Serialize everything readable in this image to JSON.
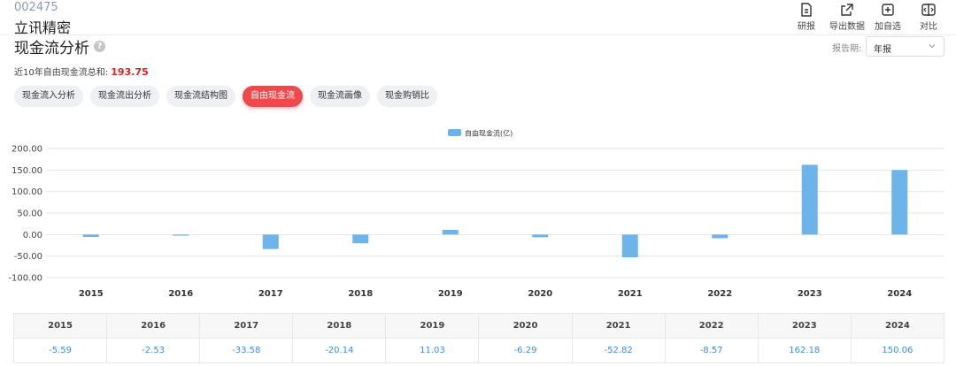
{
  "header": {
    "stock_code": "002475",
    "stock_name": "立讯精密"
  },
  "toolbar": [
    {
      "label": "研报",
      "icon": "report-icon"
    },
    {
      "label": "导出数据",
      "icon": "export-icon"
    },
    {
      "label": "加自选",
      "icon": "add-watchlist-icon"
    },
    {
      "label": "对比",
      "icon": "compare-icon"
    }
  ],
  "section": {
    "title": "现金流分析",
    "help_icon": "?",
    "period_label": "报告期:",
    "period_value": "年报"
  },
  "summary": {
    "label": "近10年自由现金流总和:",
    "value": "193.75"
  },
  "tabs": [
    {
      "label": "现金流入分析",
      "active": false
    },
    {
      "label": "现金流出分析",
      "active": false
    },
    {
      "label": "现金流结构图",
      "active": false
    },
    {
      "label": "自由现金流",
      "active": true
    },
    {
      "label": "现金流画像",
      "active": false
    },
    {
      "label": "现金购销比",
      "active": false
    }
  ],
  "chart_data": {
    "type": "bar",
    "categories": [
      "2015",
      "2016",
      "2017",
      "2018",
      "2019",
      "2020",
      "2021",
      "2022",
      "2023",
      "2024"
    ],
    "series": [
      {
        "name": "自由现金流(亿)",
        "values": [
          -5.59,
          -2.53,
          -33.58,
          -20.14,
          11.03,
          -6.29,
          -52.82,
          -8.57,
          162.18,
          150.06
        ],
        "color": "#6cb4ea"
      }
    ],
    "y_ticks": [
      "200.00",
      "150.00",
      "100.00",
      "50.00",
      "0.00",
      "-50.00",
      "-100.00"
    ],
    "ylim": [
      -100,
      200
    ],
    "legend_position": "top-center",
    "grid": true
  },
  "table": {
    "years": [
      "2015",
      "2016",
      "2017",
      "2018",
      "2019",
      "2020",
      "2021",
      "2022",
      "2023",
      "2024"
    ],
    "values": [
      "-5.59",
      "-2.53",
      "-33.58",
      "-20.14",
      "11.03",
      "-6.29",
      "-52.82",
      "-8.57",
      "162.18",
      "150.06"
    ]
  },
  "colors": {
    "accent": "#f0494d",
    "bar": "#6cb4ea",
    "sum_value": "#e02020",
    "table_value": "#3a8ee6"
  }
}
